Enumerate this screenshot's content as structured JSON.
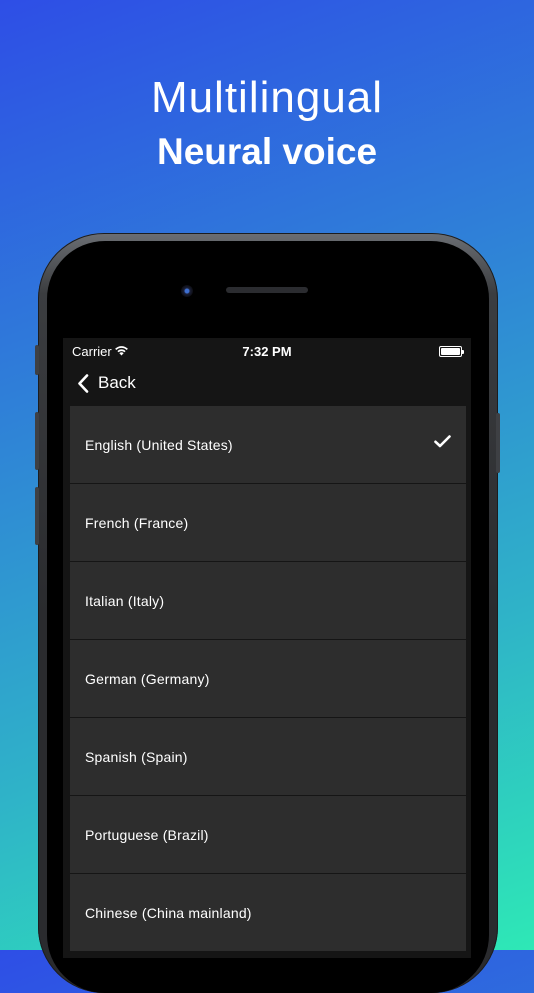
{
  "headline": {
    "line1": "Multilingual",
    "line2": "Neural voice"
  },
  "status_bar": {
    "carrier": "Carrier",
    "time": "7:32 PM"
  },
  "navbar": {
    "back_label": "Back"
  },
  "languages": [
    {
      "label": "English (United States)",
      "selected": true
    },
    {
      "label": "French (France)",
      "selected": false
    },
    {
      "label": "Italian (Italy)",
      "selected": false
    },
    {
      "label": "German (Germany)",
      "selected": false
    },
    {
      "label": "Spanish (Spain)",
      "selected": false
    },
    {
      "label": "Portuguese (Brazil)",
      "selected": false
    },
    {
      "label": "Chinese (China mainland)",
      "selected": false
    }
  ]
}
